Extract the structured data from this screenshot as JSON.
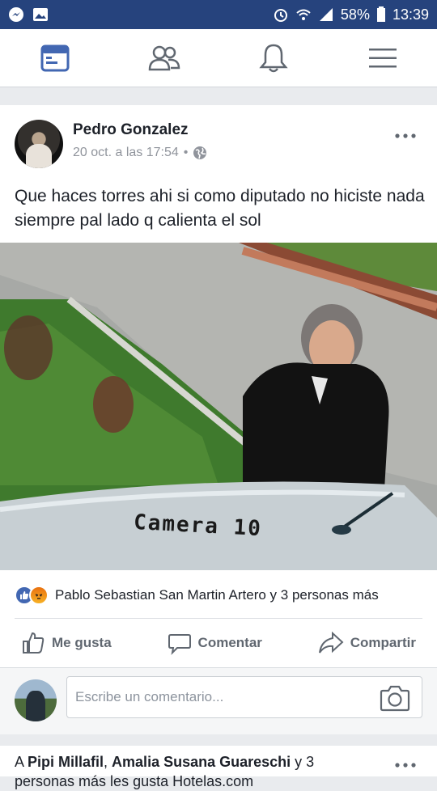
{
  "status_bar": {
    "battery": "58%",
    "time": "13:39",
    "icons": [
      "messenger-icon",
      "gallery-icon",
      "alarm-icon",
      "wifi-icon",
      "signal-icon",
      "battery-icon"
    ]
  },
  "nav": {
    "icons": [
      "news-feed-icon",
      "friends-icon",
      "notifications-icon",
      "menu-icon"
    ],
    "accent": "#4267b2"
  },
  "post": {
    "author": "Pedro Gonzalez",
    "timestamp": "20 oct. a las 17:54",
    "audience_separator": "•",
    "text": "Que haces torres ahi si como diputado no hiciste nada siempre pal lado q calienta el sol",
    "image_caption_overlay": "Camera 10",
    "reactions_text": "Pablo Sebastian San Martin Artero y 3 personas más",
    "actions": {
      "like": "Me gusta",
      "comment": "Comentar",
      "share": "Compartir"
    },
    "comment_placeholder": "Escribe un comentario..."
  },
  "next_post": {
    "prefix": "A ",
    "name1": "Pipi Millafil",
    "sep": ", ",
    "name2": "Amalia Susana Guareschi",
    "suffix": " y 3",
    "line2": "personas más les gusta Hotelas.com"
  }
}
